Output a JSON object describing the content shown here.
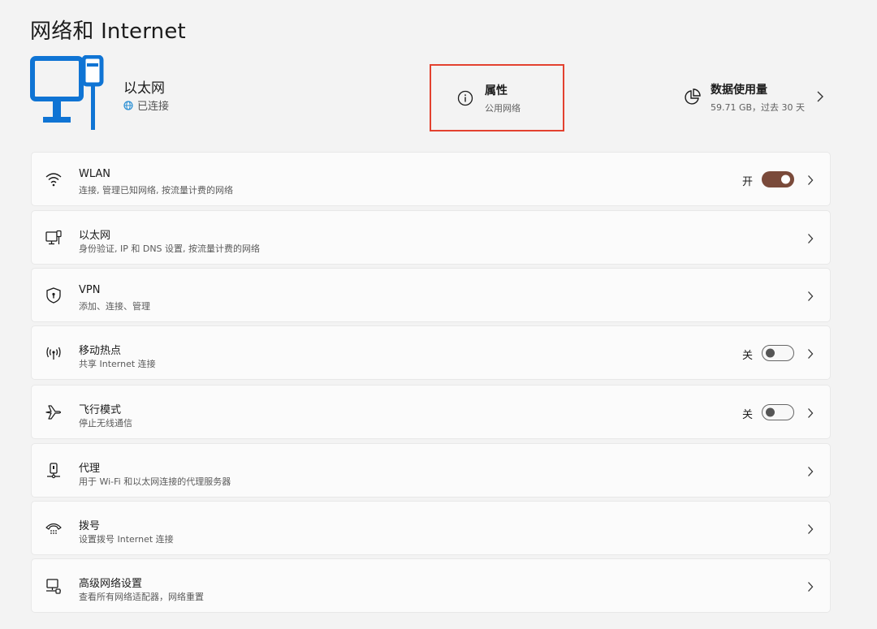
{
  "page": {
    "title": "网络和 Internet"
  },
  "hero": {
    "name": "以太网",
    "status": "已连接"
  },
  "properties": {
    "title": "属性",
    "subtitle": "公用网络"
  },
  "usage": {
    "title": "数据使用量",
    "subtitle": "59.71 GB，过去 30 天"
  },
  "rows": [
    {
      "title": "WLAN",
      "subtitle": "连接, 管理已知网络, 按流量计费的网络",
      "toggle_label": "开",
      "toggle_on": true,
      "icon": "wifi-icon"
    },
    {
      "title": "以太网",
      "subtitle": "身份验证, IP 和 DNS 设置, 按流量计费的网络",
      "icon": "ethernet-icon"
    },
    {
      "title": "VPN",
      "subtitle": "添加、连接、管理",
      "icon": "shield-icon"
    },
    {
      "title": "移动热点",
      "subtitle": "共享 Internet 连接",
      "toggle_label": "关",
      "toggle_on": false,
      "icon": "hotspot-icon"
    },
    {
      "title": "飞行模式",
      "subtitle": "停止无线通信",
      "toggle_label": "关",
      "toggle_on": false,
      "icon": "airplane-icon"
    },
    {
      "title": "代理",
      "subtitle": "用于 Wi-Fi 和以太网连接的代理服务器",
      "icon": "proxy-icon"
    },
    {
      "title": "拨号",
      "subtitle": "设置拨号 Internet 连接",
      "icon": "dialup-icon"
    },
    {
      "title": "高级网络设置",
      "subtitle": "查看所有网络适配器，网络重置",
      "icon": "advanced-network-icon"
    }
  ],
  "colors": {
    "accent": "#7a4a3a",
    "highlight": "#e3412f",
    "monitor_blue": "#0f74d4"
  }
}
